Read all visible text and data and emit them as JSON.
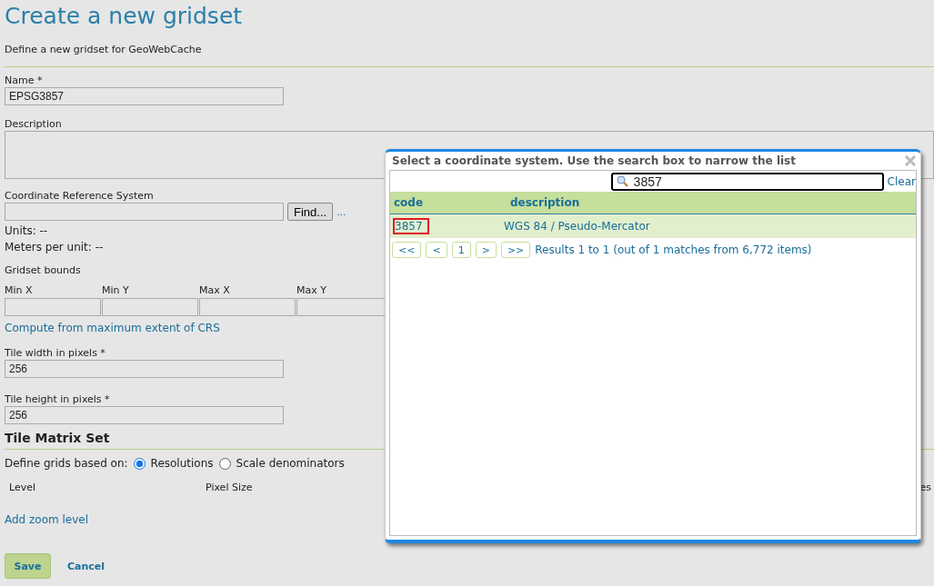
{
  "page": {
    "title": "Create a new gridset",
    "subtitle": "Define a new gridset for GeoWebCache"
  },
  "form": {
    "name": {
      "label": "Name *",
      "value": "EPSG3857"
    },
    "description": {
      "label": "Description"
    },
    "crs": {
      "label": "Coordinate Reference System",
      "find_button": "Find...",
      "more_link": "...",
      "units": "Units: --",
      "meters_per_unit": "Meters per unit: --"
    },
    "bounds": {
      "label": "Gridset bounds",
      "fields": [
        "Min X",
        "Min Y",
        "Max X",
        "Max Y"
      ],
      "compute_link": "Compute from maximum extent of CRS"
    },
    "tile_width": {
      "label": "Tile width in pixels *",
      "value": "256"
    },
    "tile_height": {
      "label": "Tile height in pixels *",
      "value": "256"
    }
  },
  "tile_matrix_set": {
    "heading": "Tile Matrix Set",
    "define_label": "Define grids based on:",
    "options": [
      {
        "label": "Resolutions",
        "selected": true
      },
      {
        "label": "Scale denominators",
        "selected": false
      }
    ],
    "columns": [
      "Level",
      "Pixel Size",
      "es"
    ],
    "add_link": "Add zoom level"
  },
  "actions": {
    "save": "Save",
    "cancel": "Cancel"
  },
  "dialog": {
    "title": "Select a coordinate system. Use the search box to narrow the list",
    "search_value": "3857",
    "clear_link": "Clear",
    "columns": [
      "code",
      "description"
    ],
    "rows": [
      {
        "code": "3857",
        "description": "WGS 84 / Pseudo-Mercator",
        "highlighted": true
      }
    ],
    "pager": [
      "<<",
      "<",
      "1",
      ">",
      ">>"
    ],
    "results": "Results 1 to 1 (out of 1 matches from 6,772 items)"
  }
}
